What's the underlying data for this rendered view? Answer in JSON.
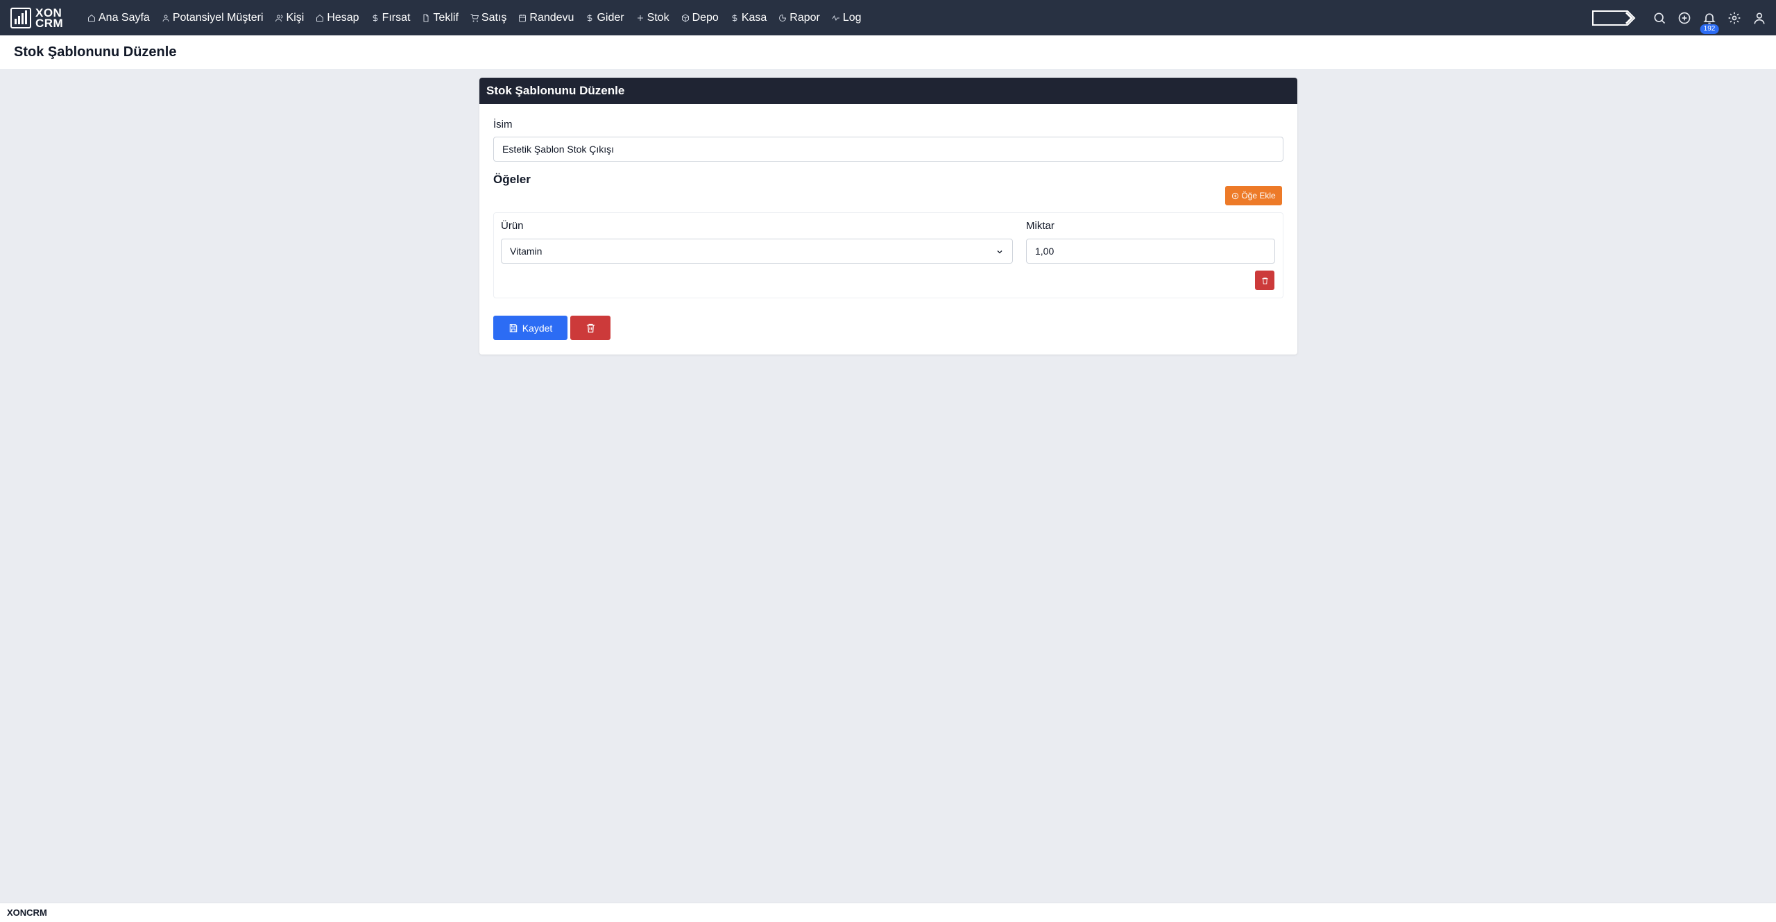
{
  "app": {
    "logo_line1": "XON",
    "logo_line2": "CRM"
  },
  "nav": {
    "items": [
      {
        "label": "Ana Sayfa",
        "icon": "home-icon"
      },
      {
        "label": "Potansiyel Müşteri",
        "icon": "user-icon"
      },
      {
        "label": "Kişi",
        "icon": "users-icon"
      },
      {
        "label": "Hesap",
        "icon": "home-icon"
      },
      {
        "label": "Fırsat",
        "icon": "dollar-icon"
      },
      {
        "label": "Teklif",
        "icon": "file-icon"
      },
      {
        "label": "Satış",
        "icon": "cart-icon"
      },
      {
        "label": "Randevu",
        "icon": "calendar-icon"
      },
      {
        "label": "Gider",
        "icon": "dollar-icon"
      },
      {
        "label": "Stok",
        "icon": "plus-icon"
      },
      {
        "label": "Depo",
        "icon": "box-icon"
      },
      {
        "label": "Kasa",
        "icon": "dollar-icon"
      },
      {
        "label": "Rapor",
        "icon": "pie-chart-icon"
      },
      {
        "label": "Log",
        "icon": "activity-icon"
      }
    ],
    "notification_count": "192"
  },
  "page": {
    "title": "Stok Şablonunu Düzenle"
  },
  "form": {
    "card_title": "Stok Şablonunu Düzenle",
    "name_label": "İsim",
    "name_value": "Estetik Şablon Stok Çıkışı",
    "items_title": "Öğeler",
    "add_item_label": "Öğe Ekle",
    "items": [
      {
        "product_label": "Ürün",
        "product_value": "Vitamin",
        "quantity_label": "Miktar",
        "quantity_value": "1,00"
      }
    ],
    "save_label": "Kaydet"
  },
  "footer": {
    "text": "XONCRM"
  },
  "colors": {
    "nav_bg": "#283142",
    "card_header_bg": "#1f2433",
    "primary": "#2c6cf4",
    "danger": "#cc3a3a",
    "warning": "#ed7a28",
    "page_bg": "#eaecf1"
  }
}
